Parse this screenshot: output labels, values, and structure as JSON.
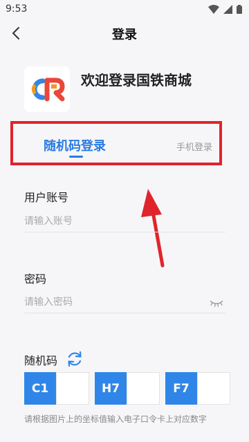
{
  "status_bar": {
    "time": "9:53"
  },
  "header": {
    "title": "登录"
  },
  "welcome": {
    "title": "欢迎登录国铁商城"
  },
  "tabs": {
    "random_code": "随机码登录",
    "phone": "手机登录"
  },
  "account": {
    "label": "用户账号",
    "placeholder": "请输入账号"
  },
  "password": {
    "label": "密码",
    "placeholder": "请输入密码"
  },
  "random_code": {
    "label": "随机码",
    "cells": [
      "C1",
      "H7",
      "F7"
    ],
    "hint": "请根据图片上的坐标值输入电子口令卡上对应数字"
  },
  "colors": {
    "accent": "#2a7be4",
    "code_tag": "#2f86e8",
    "annotation": "#e0242c"
  },
  "icons": [
    "back-icon",
    "wifi-icon",
    "signal-icon",
    "battery-icon",
    "app-logo",
    "eye-closed-icon",
    "refresh-icon"
  ]
}
